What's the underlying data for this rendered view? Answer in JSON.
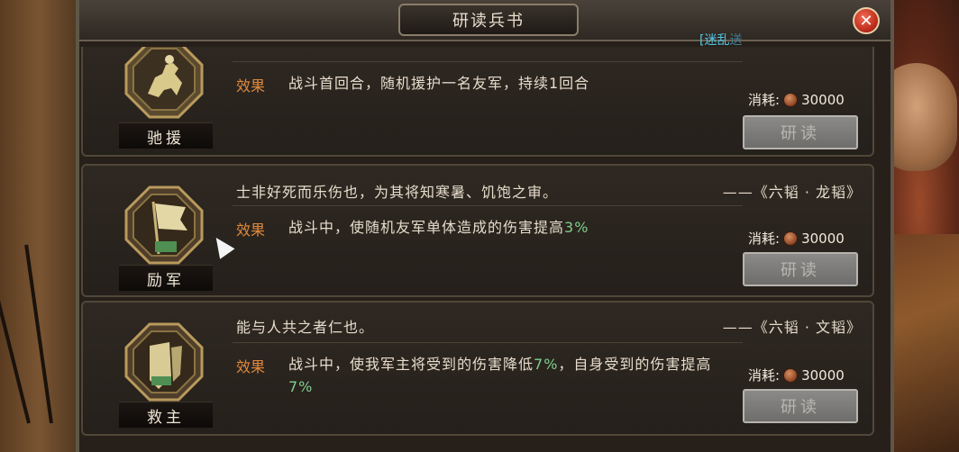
{
  "dialog": {
    "title": "研读兵书",
    "close_icon": "close-icon",
    "tag": "[迷乱",
    "tag_faded": "送"
  },
  "colors": {
    "effect_label": "#e08a3c",
    "percent": "#7fcf8c",
    "tag": "#53c6e8",
    "close": "#c1301f"
  },
  "cost_label": "消耗:",
  "study_label": "研读",
  "skills": [
    {
      "name": "驰援",
      "icon": "horse-rider-icon",
      "quote": "",
      "source": "",
      "effect_label": "效果",
      "effect_text": "战斗首回合，随机援护一名友军，持续1回合",
      "cost": "30000"
    },
    {
      "name": "励军",
      "icon": "banner-icon",
      "quote": "士非好死而乐伤也，为其将知寒暑、饥饱之审。",
      "source": "——《六韬 · 龙韬》",
      "effect_label": "效果",
      "effect_text_pre": "战斗中，使随机友军单体造成的伤害提高",
      "effect_pct": "3%",
      "cost": "30000"
    },
    {
      "name": "救主",
      "icon": "shield-icon",
      "quote": "能与人共之者仁也。",
      "source": "——《六韬 · 文韬》",
      "effect_label": "效果",
      "effect_text_1": "战斗中，使我军主将受到的伤害降低",
      "effect_pct_1": "7%",
      "effect_text_2": "，自身受到的伤害提高",
      "effect_pct_2": "7%",
      "cost": "30000"
    }
  ]
}
